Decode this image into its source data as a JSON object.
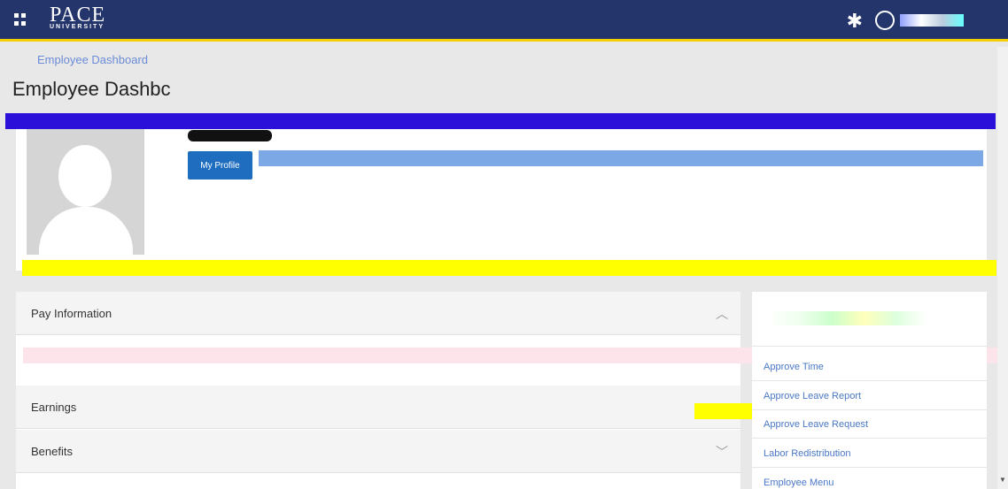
{
  "header": {
    "logo_word": "PACE",
    "logo_sub": "UNIVERSITY",
    "menu_icon": "grid-icon",
    "settings_icon": "gear-icon",
    "user_icon": "user-icon"
  },
  "breadcrumb": "Employee Dashboard",
  "page_title": "Employee Dashbc",
  "profile": {
    "button_label": "My Profile"
  },
  "sections": {
    "pay": {
      "label": "Pay Information",
      "chevron": "chevron-up-icon"
    },
    "earnings": {
      "label": "Earnings"
    },
    "benefits": {
      "label": "Benefits",
      "chevron": "chevron-down-icon"
    }
  },
  "links": [
    {
      "label": "Approve Time"
    },
    {
      "label": "Approve Leave Report"
    },
    {
      "label": "Approve Leave Request"
    },
    {
      "label": "Labor Redistribution"
    },
    {
      "label": "Employee Menu"
    }
  ],
  "colors": {
    "header_bg": "#23356b",
    "accent": "#f5d000",
    "button_bg": "#1e6dbf",
    "link": "#4a78c6"
  }
}
